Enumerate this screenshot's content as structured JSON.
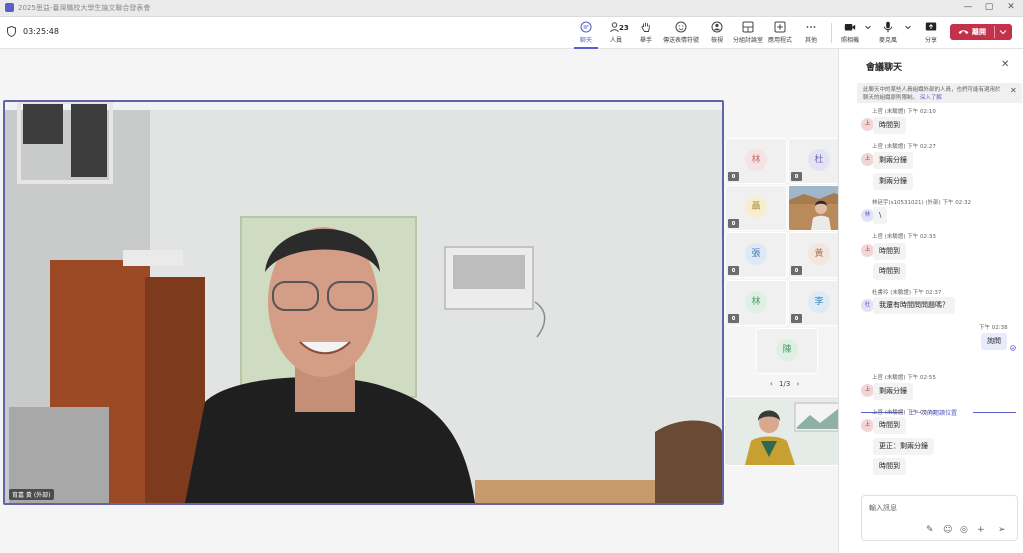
{
  "window": {
    "title": "2025思益-臺灣職校大學生論文聯合發表會",
    "controls": {
      "minimize": "—",
      "maximize": "▢",
      "close": "✕"
    }
  },
  "meeting": {
    "timer": "03:25:48"
  },
  "toolbar": {
    "chat_label": "聊天",
    "people_label": "人員",
    "people_count": "23",
    "raise_label": "舉手",
    "react_label": "傳送表情符號",
    "view_label": "檢視",
    "rooms_label": "分組討論室",
    "apps_label": "應用程式",
    "more_label": "其他",
    "camera_label": "照相機",
    "mic_label": "麥克風",
    "share_label": "分享",
    "leave_label": "離開"
  },
  "stage": {
    "main_participant": "育嘉 黃 (外部)",
    "tiles": [
      {
        "initial": "林",
        "color": "#c86b6b",
        "bg": "#f5e3e3"
      },
      {
        "initial": "杜",
        "color": "#6b6bb8",
        "bg": "#e4e3f5"
      },
      {
        "initial": "聶",
        "color": "#a58a2a",
        "bg": "#f7eed2"
      },
      {
        "initial": "張",
        "color": "#4a78b5",
        "bg": "#dfe8f5"
      },
      {
        "initial": "黃",
        "color": "#a8775a",
        "bg": "#f4e6dc"
      },
      {
        "initial": "林",
        "color": "#4f9a6c",
        "bg": "#ddf0e3"
      },
      {
        "initial": "李",
        "color": "#3d7fb0",
        "bg": "#dcebf6"
      },
      {
        "initial": "陳",
        "color": "#4f9a6c",
        "bg": "#ddf0e3"
      }
    ],
    "pager": "1/3"
  },
  "chat": {
    "title": "會議聊天",
    "notice": "此聊天中的某些人員組織外部的人員，也們可能有適用於聊天的組織原則限制。",
    "notice_link": "深入了解",
    "messages": [
      {
        "meta": "上官 (未驗證)   下午 02:10",
        "initial": "上",
        "bubbles": [
          "時間到"
        ]
      },
      {
        "meta": "上官 (未驗證)   下午 02:27",
        "initial": "上",
        "bubbles": [
          "剩兩分鐘",
          "剩兩分鐘"
        ]
      },
      {
        "meta": "林廷宇(s10531021) (外部)   下午 02:32",
        "initial": "林",
        "bubbles": [
          "\\"
        ]
      },
      {
        "meta": "上官 (未驗證)   下午 02:33",
        "initial": "上",
        "bubbles": [
          "時間到",
          "時間到"
        ]
      },
      {
        "meta": "杜書玲 (未驗證)   下午 02:37",
        "initial": "杜",
        "bubbles": [
          "我還有時間問問題嗎？"
        ]
      },
      {
        "meta": "下午 02:38",
        "mine": true,
        "bubbles": [
          "詢問"
        ]
      },
      {
        "meta": "上官 (未驗證)   下午 02:55",
        "initial": "上",
        "bubbles": [
          "剩兩分鐘"
        ]
      },
      {
        "meta": "上官 (未驗證)   下午 03:01",
        "initial": "上",
        "bubbles": [
          "時間到",
          "更正：剩兩分鐘",
          "時間到"
        ]
      }
    ],
    "divider": "上一次的閱讀位置",
    "compose_placeholder": "輸入訊息"
  }
}
